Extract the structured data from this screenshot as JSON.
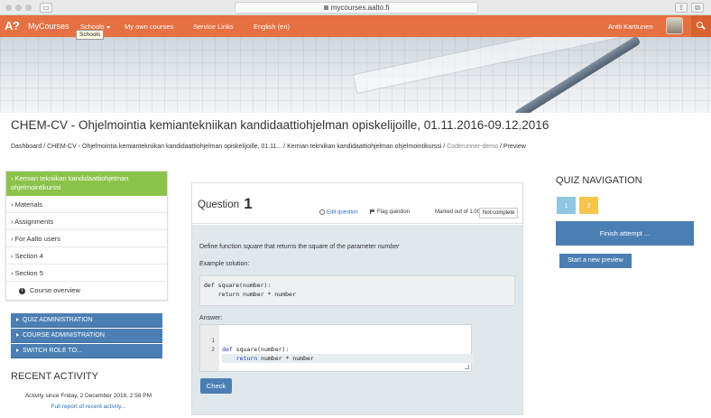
{
  "browser": {
    "url": "mycourses.aalto.fi"
  },
  "navbar": {
    "logo": "A?",
    "brand": "MyCourses",
    "schools": "Schools",
    "own_courses": "My own courses",
    "service_links": "Service Links",
    "language": "English (en)",
    "user": "Antti Karttunen",
    "tooltip": "Schools"
  },
  "header": {
    "title": "CHEM-CV - Ohjelmointia kemiantekniikan kandidaattiohjelman opiskelijoille, 01.11.2016-09.12.2016"
  },
  "breadcrumb": {
    "items": [
      "Dashboard",
      "CHEM-CV - Ohjelmointia kemiantekniikan kandidaattiohjelman opiskelijoille, 01.11...",
      "Kemian tekniikan kandidaattiohjelman ohjelmointikurssi",
      "Coderunner-demo",
      "Preview"
    ],
    "separator": "/"
  },
  "course_nav": {
    "active": "Kemian tekniikan kandidaattiohjelman ohjelmointikurssi",
    "items": [
      "Materials",
      "Assignments",
      "For Aalto users",
      "Section 4",
      "Section 5"
    ],
    "overview": "Course overview"
  },
  "admin_blocks": [
    "QUIZ ADMINISTRATION",
    "COURSE ADMINISTRATION",
    "SWITCH ROLE TO..."
  ],
  "recent_activity": {
    "title": "RECENT ACTIVITY",
    "since": "Activity since Friday, 2 December 2016, 2:56 PM",
    "report_link": "Full report of recent activity..."
  },
  "question": {
    "label": "Question",
    "number": "1",
    "edit": "Edit question",
    "flag": "Flag question",
    "marked": "Marked out of 1.00",
    "status": "Not complete",
    "prompt_pre": "Define function ",
    "prompt_fn": "square",
    "prompt_mid": " that returns the square of the parameter ",
    "prompt_param": "number",
    "example_label": "Example solution:",
    "example_code": "def square(number):\n    return number * number",
    "answer_label": "Answer:",
    "code_lines": [
      {
        "num": "1",
        "kw": "def",
        "rest": " square(number):"
      },
      {
        "num": "2",
        "kw": "    return",
        "rest": " number * number"
      }
    ],
    "check_label": "Check"
  },
  "quiz_nav": {
    "title": "QUIZ NAVIGATION",
    "buttons": [
      "1",
      "2"
    ],
    "button_colors": [
      "#8fc7e3",
      "#f4c64e"
    ],
    "finish": "Finish attempt ...",
    "new_preview": "Start a new preview"
  }
}
